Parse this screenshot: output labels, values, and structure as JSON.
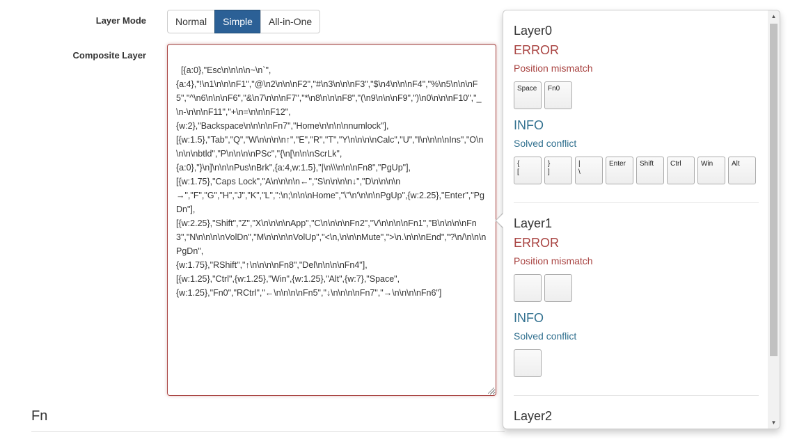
{
  "form": {
    "layer_mode_label": "Layer Mode",
    "composite_label": "Composite Layer",
    "modes": [
      {
        "label": "Normal",
        "active": false
      },
      {
        "label": "Simple",
        "active": true
      },
      {
        "label": "All-in-One",
        "active": false
      }
    ],
    "composite_value": "[{a:0},\"Esc\\n\\n\\n\\n~\\n`\",\n{a:4},\"!\\n1\\n\\n\\nF1\",\"@\\n2\\n\\n\\nF2\",\"#\\n3\\n\\n\\nF3\",\"$\\n4\\n\\n\\nF4\",\"%\\n5\\n\\n\\nF5\",\"^\\n6\\n\\n\\nF6\",\"&\\n7\\n\\n\\nF7\",\"*\\n8\\n\\n\\nF8\",\"(\\n9\\n\\n\\nF9\",\")\\n0\\n\\n\\nF10\",\"_\\n-\\n\\n\\nF11\",\"+\\n=\\n\\n\\nF12\",\n{w:2},\"Backspace\\n\\n\\n\\nFn7\",\"Home\\n\\n\\n\\nnumlock\"],\n[{w:1.5},\"Tab\",\"Q\",\"W\\n\\n\\n\\n↑\",\"E\",\"R\",\"T\",\"Y\\n\\n\\n\\nCalc\",\"U\",\"I\\n\\n\\n\\nIns\",\"O\\n\\n\\n\\nbtld\",\"P\\n\\n\\n\\nPSc\",\"{\\n[\\n\\n\\nScrLk\",\n{a:0},\"}\\n]\\n\\n\\nPus\\nBrk\",{a:4,w:1.5},\"|\\n\\\\\\n\\n\\nFn8\",\"PgUp\"],\n[{w:1.75},\"Caps Lock\",\"A\\n\\n\\n\\n←\",\"S\\n\\n\\n\\n↓\",\"D\\n\\n\\n\\n→\",\"F\",\"G\",\"H\",\"J\",\"K\",\"L\",\":\\n;\\n\\n\\nHome\",\"\\\"\\n'\\n\\n\\nPgUp\",{w:2.25},\"Enter\",\"PgDn\"],\n[{w:2.25},\"Shift\",\"Z\",\"X\\n\\n\\n\\nApp\",\"C\\n\\n\\n\\nFn2\",\"V\\n\\n\\n\\nFn1\",\"B\\n\\n\\n\\nFn3\",\"N\\n\\n\\n\\nVolDn\",\"M\\n\\n\\n\\nVolUp\",\"<\\n,\\n\\n\\nMute\",\">\\n.\\n\\n\\nEnd\",\"?\\n/\\n\\n\\nPgDn\",\n{w:1.75},\"RShift\",\"↑\\n\\n\\n\\nFn8\",\"Del\\n\\n\\n\\nFn4\"],\n[{w:1.25},\"Ctrl\",{w:1.25},\"Win\",{w:1.25},\"Alt\",{w:7},\"Space\",\n{w:1.25},\"Fn0\",\"RCtrl\",\"←\\n\\n\\n\\nFn5\",\"↓\\n\\n\\n\\nFn7\",\"→\\n\\n\\n\\nFn6\"]"
  },
  "section": {
    "title": "Fn"
  },
  "popover": {
    "layers": [
      {
        "title": "Layer0",
        "error": {
          "heading": "ERROR",
          "message": "Position mismatch",
          "keys": [
            "Space",
            "Fn0"
          ]
        },
        "info": {
          "heading": "INFO",
          "message": "Solved conflict",
          "keys": [
            "{\n[",
            "}\n]",
            "|\n\\",
            "Enter",
            "Shift",
            "Ctrl",
            "Win",
            "Alt"
          ]
        }
      },
      {
        "title": "Layer1",
        "error": {
          "heading": "ERROR",
          "message": "Position mismatch",
          "keys": [
            "",
            ""
          ]
        },
        "info": {
          "heading": "INFO",
          "message": "Solved conflict",
          "keys": [
            ""
          ]
        }
      },
      {
        "title": "Layer2"
      }
    ]
  },
  "colors": {
    "active_button": "#2b6096",
    "error": "#a94442",
    "info": "#31708f"
  }
}
